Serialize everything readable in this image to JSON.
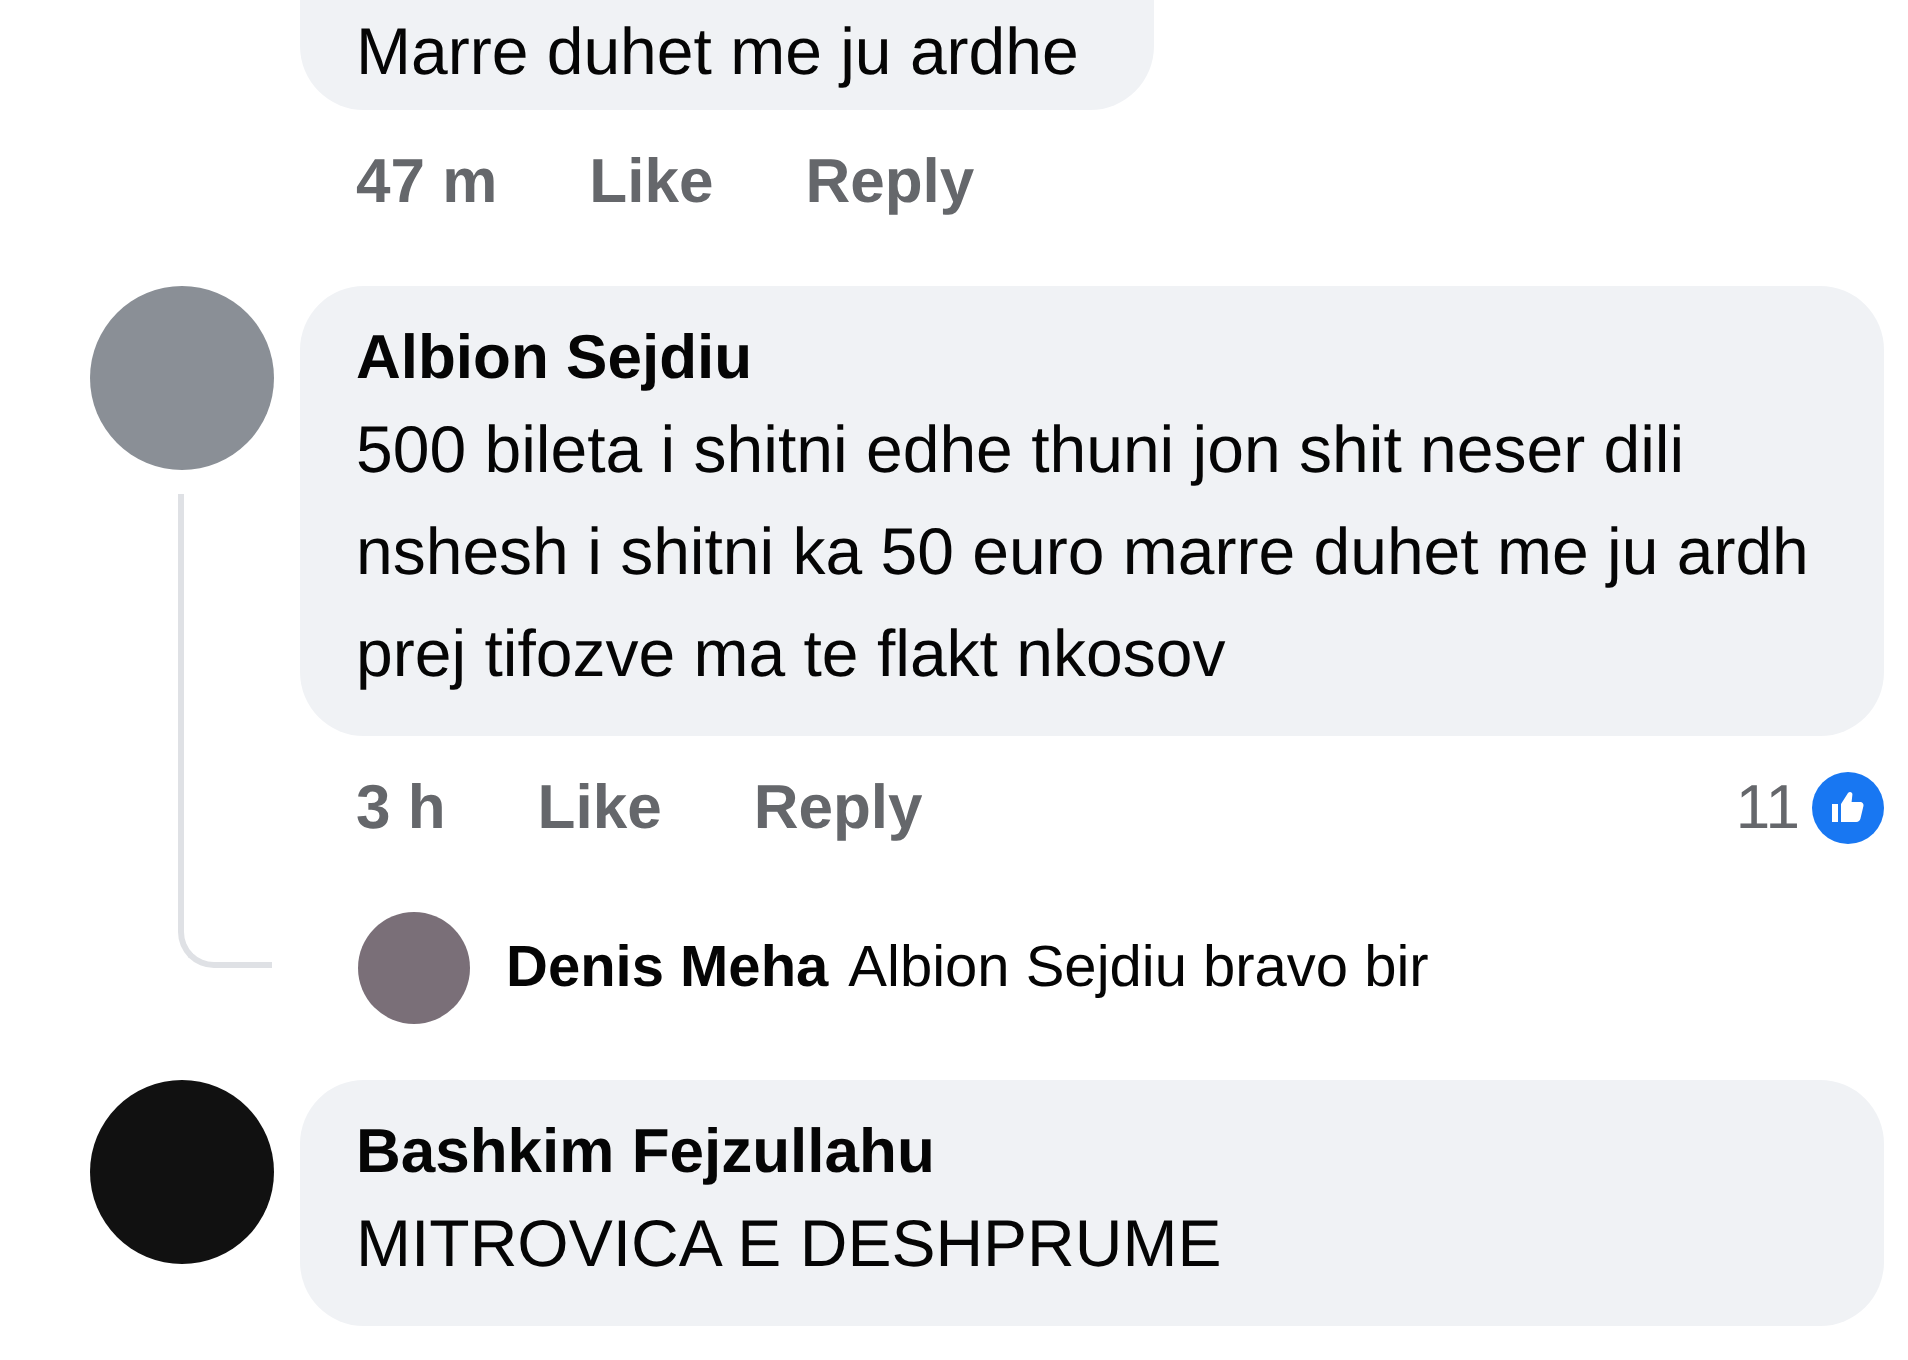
{
  "previous_comment": {
    "text": "Marre duhet me ju ardhe",
    "time": "47 m",
    "actions": [
      "Like",
      "Reply"
    ]
  },
  "comments": [
    {
      "author": "Albion Sejdiu",
      "text": "500 bileta i shitni edhe thuni jon shit neser dili nshesh i shitni ka 50 euro marre duhet me ju ardh prej tifozve ma te flakt nkosov",
      "time": "3 h",
      "actions": [
        "Like",
        "Reply"
      ],
      "reaction_count": "11",
      "replies": [
        {
          "author": "Denis Meha",
          "text": "Albion Sejdiu bravo bir"
        }
      ]
    },
    {
      "author": "Bashkim Fejzullahu",
      "text": "MITROVICA E DESHPRUME"
    }
  ]
}
